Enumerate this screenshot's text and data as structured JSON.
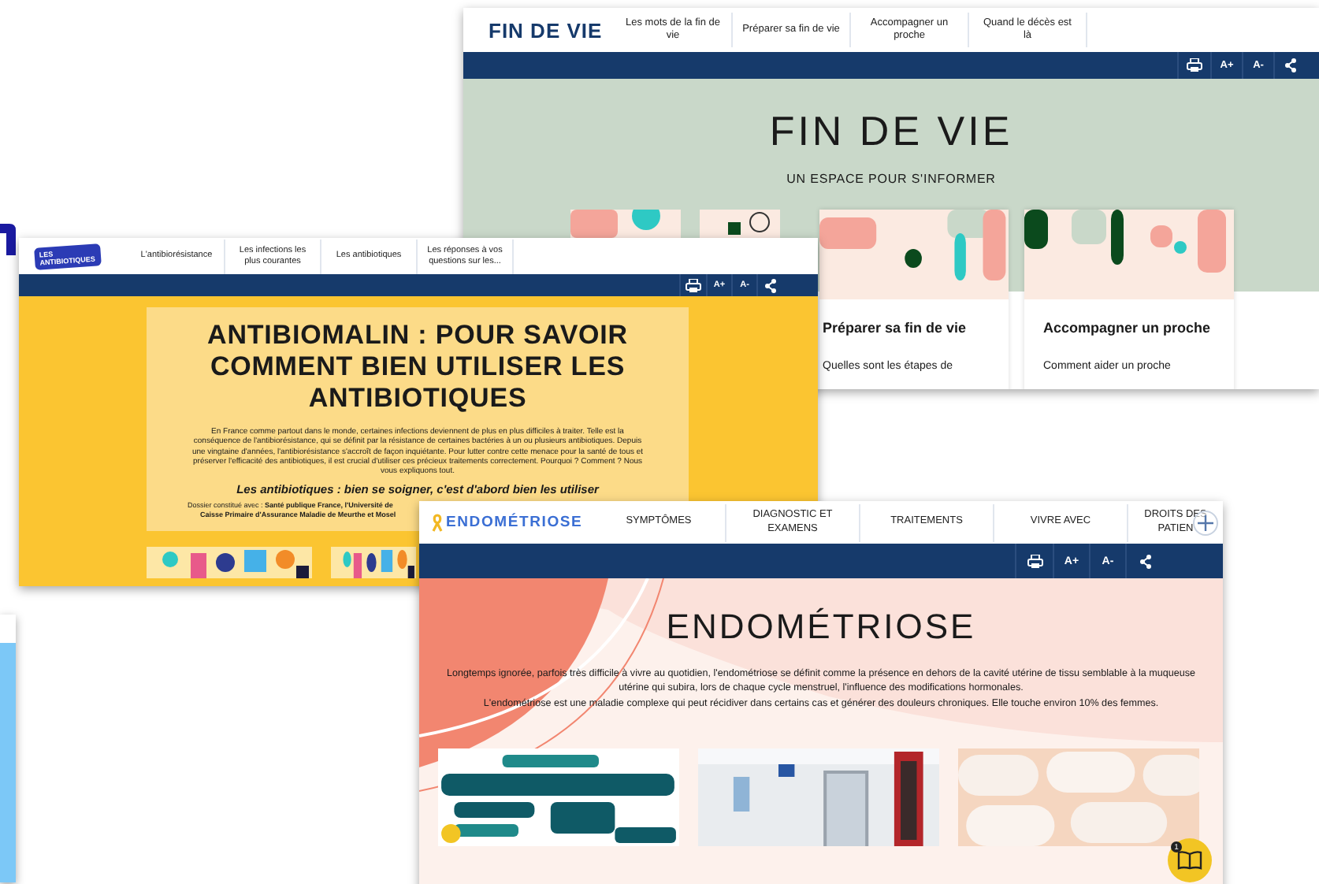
{
  "fin_de_vie_page": {
    "brand": "FIN DE VIE",
    "nav": [
      "Les mots de la fin de vie",
      "Préparer sa fin de vie",
      "Accompagner un proche",
      "Quand le décès est là"
    ],
    "toolbar": {
      "font_larger": "A+",
      "font_smaller": "A-"
    },
    "title": "FIN DE VIE",
    "subtitle": "UN ESPACE POUR S'INFORMER",
    "cards": [
      {
        "kind": "picture"
      },
      {
        "title": "Préparer sa fin de vie",
        "description": "Quelles sont les étapes de"
      },
      {
        "title": "Accompagner un proche",
        "description": "Comment aider un proche"
      }
    ]
  },
  "antibiotiques_page": {
    "logo": "LES ANTIBIOTIQUES",
    "nav": [
      "L'antibiorésistance",
      "Les infections les plus courantes",
      "Les antibiotiques",
      "Les réponses à vos questions sur les..."
    ],
    "toolbar": {
      "font_larger": "A+",
      "font_smaller": "A-"
    },
    "title": "ANTIBIOMALIN : POUR SAVOIR COMMENT BIEN UTILISER LES ANTIBIOTIQUES",
    "intro": "En France comme partout dans le monde, certaines infections deviennent de plus en plus difficiles à traiter. Telle est la conséquence de l'antibiorésistance, qui se définit par la résistance de certaines bactéries à un ou plusieurs antibiotiques. Depuis une vingtaine d'années, l'antibiorésistance s'accroît de façon inquiétante. Pour lutter contre cette menace pour la santé de tous et préserver l'efficacité des antibiotiques, il est crucial d'utiliser ces précieux traitements correctement. Pourquoi ? Comment ? Nous vous expliquons tout.",
    "tagline": "Les antibiotiques : bien se soigner, c'est d'abord bien les utiliser",
    "credits": [
      "Dossier constitué avec : **Santé publique France, l'Université de**",
      "**Caisse Primaire d'Assurance Maladie de Meurthe et Mosel**"
    ]
  },
  "endometriose_page": {
    "brand": "ENDOMÉTRIOSE",
    "nav": [
      "SYMPTÔMES",
      "DIAGNOSTIC ET EXAMENS",
      "TRAITEMENTS",
      "VIVRE AVEC",
      "DROITS DES PATIEN"
    ],
    "toolbar": {
      "font_larger": "A+",
      "font_smaller": "A-"
    },
    "title": "ENDOMÉTRIOSE",
    "intro": [
      "Longtemps ignorée, parfois très difficile à vivre au quotidien, l'endométriose se définit comme la présence en dehors de la cavité utérine de tissu semblable à la muqueuse utérine qui subira, lors de chaque cycle menstruel, l'influence des modifications hormonales.",
      "L'endométriose est une maladie complexe qui peut récidiver dans certains cas et générer des douleurs chroniques. Elle touche environ 10% des femmes."
    ],
    "help_badge": "1"
  }
}
